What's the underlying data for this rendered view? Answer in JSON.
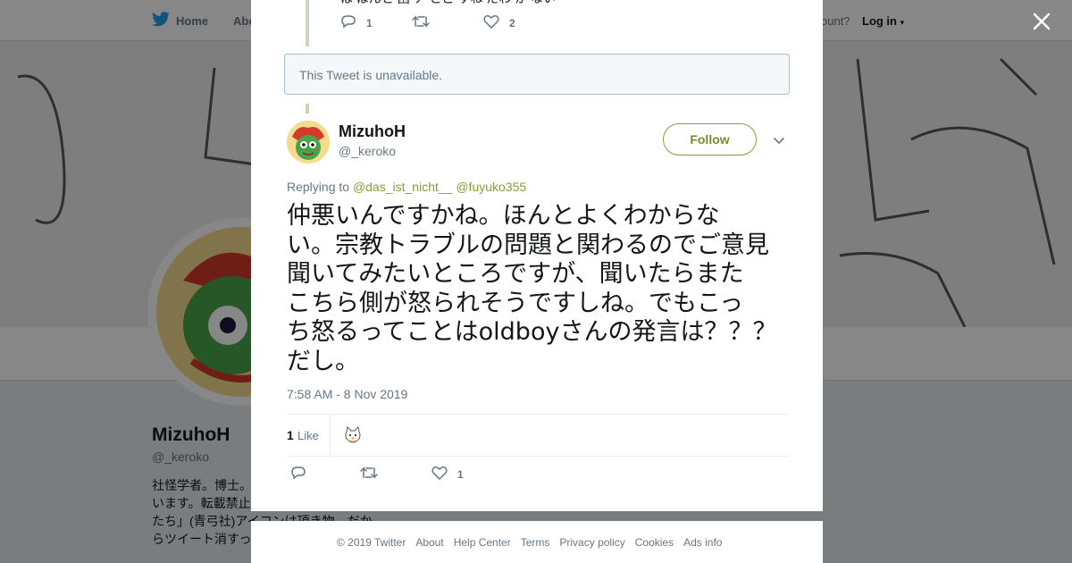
{
  "nav": {
    "home": "Home",
    "about": "Abo",
    "have_account": "ccount?",
    "login": "Log in"
  },
  "profile": {
    "name": "MizuhoH",
    "handle": "@_keroko",
    "bio": [
      "社怪学者。博士。",
      "います。転載禁止",
      "たち」(青弓社)アイコンは頂き物。だか",
      "らツイート消すっ"
    ]
  },
  "previous_tweet": {
    "partial_text": "は ほんと 困 ナ   とこ  すね  だわ  か   ない",
    "reply_count": "1",
    "like_count": "2"
  },
  "unavailable_notice": "This Tweet is unavailable.",
  "tweet": {
    "author_name": "MizuhoH",
    "author_handle": "@_keroko",
    "follow_label": "Follow",
    "replying_label": "Replying to",
    "reply_to": [
      "@das_ist_nicht__",
      "@fuyuko355"
    ],
    "text_lines": [
      "仲悪いんですかね。ほんとよくわからな",
      "い。宗教トラブルの問題と関わるのでご意見",
      "聞いてみたいところですが、聞いたらまた",
      "こちら側が怒られそうですしね。でもこっ",
      "ち怒るってことはoldboyさんの発言は？？？",
      "だし。"
    ],
    "timestamp": "7:58 AM - 8 Nov 2019",
    "like_total": "1",
    "like_label": "Like",
    "action_like_count": "1"
  },
  "footer": {
    "links": [
      "© 2019 Twitter",
      "About",
      "Help Center",
      "Terms",
      "Privacy policy",
      "Cookies",
      "Ads info"
    ]
  },
  "colors": {
    "accent": "#8a9a3b",
    "unavailable_bg": "#f5f8fa",
    "muted_text": "#657786"
  },
  "icons": [
    "twitter-bird-icon",
    "close-icon",
    "reply-icon",
    "retweet-icon",
    "heart-icon",
    "chevron-down-icon",
    "frog-avatar",
    "cat-avatar"
  ]
}
